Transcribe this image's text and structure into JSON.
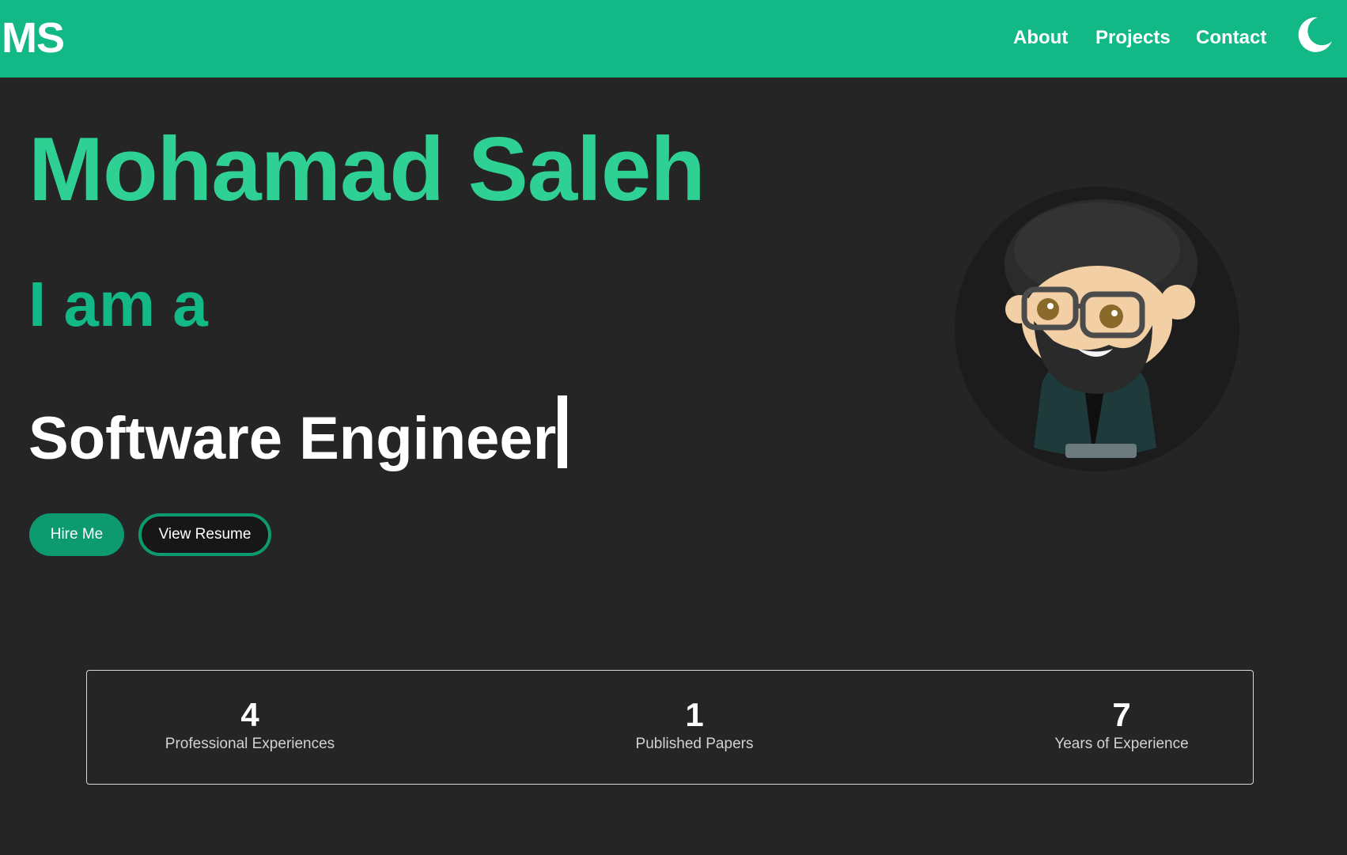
{
  "nav": {
    "logo": "MS",
    "links": [
      {
        "label": "About"
      },
      {
        "label": "Projects"
      },
      {
        "label": "Contact"
      }
    ],
    "theme_icon": "moon-icon"
  },
  "hero": {
    "name": "Mohamad Saleh",
    "intro": "I am a",
    "role": "Software Engineer",
    "buttons": {
      "hire": "Hire Me",
      "resume": "View Resume"
    },
    "avatar_icon": "cartoon-avatar"
  },
  "stats": [
    {
      "value": "4",
      "label": "Professional Experiences"
    },
    {
      "value": "1",
      "label": "Published Papers"
    },
    {
      "value": "7",
      "label": "Years of Experience"
    }
  ],
  "colors": {
    "accent": "#12b886",
    "accent_light": "#2ed193",
    "background": "#252525",
    "button": "#0c9a6e"
  }
}
